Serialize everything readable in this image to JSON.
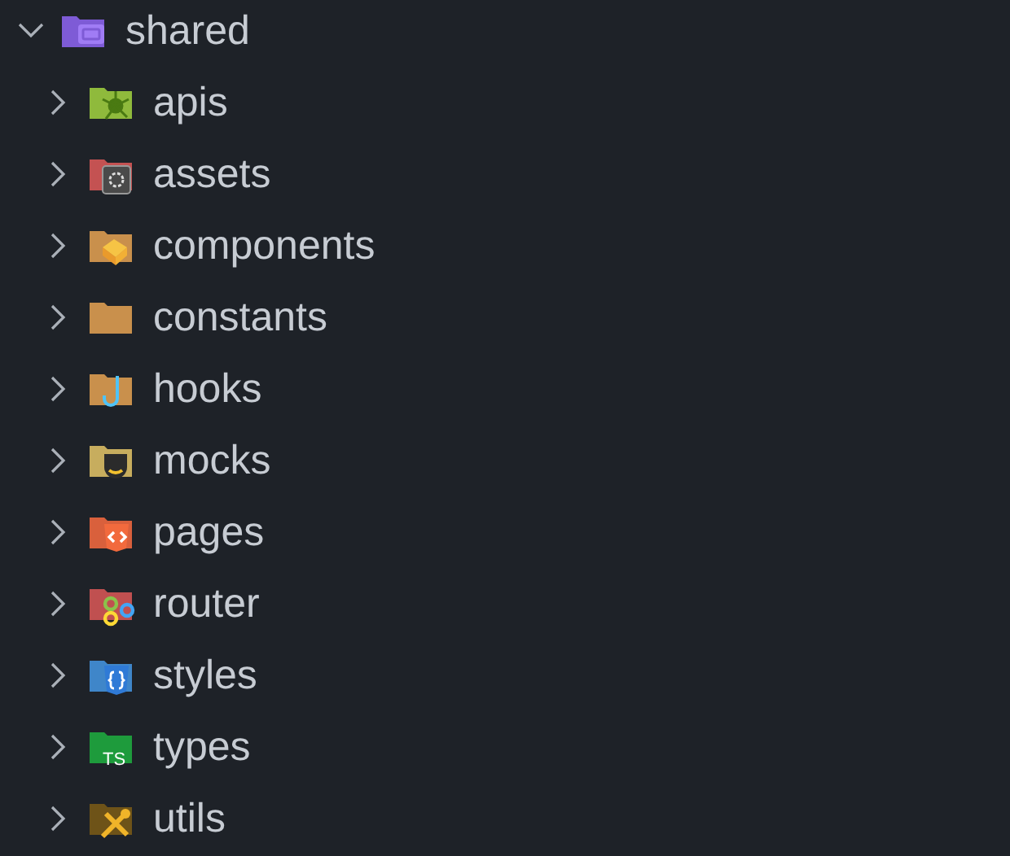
{
  "tree": {
    "label": "shared",
    "kind": "shared",
    "expanded": true,
    "children": [
      {
        "label": "apis",
        "kind": "apis",
        "expanded": false
      },
      {
        "label": "assets",
        "kind": "assets",
        "expanded": false
      },
      {
        "label": "components",
        "kind": "components",
        "expanded": false
      },
      {
        "label": "constants",
        "kind": "plain",
        "expanded": false
      },
      {
        "label": "hooks",
        "kind": "hooks",
        "expanded": false
      },
      {
        "label": "mocks",
        "kind": "mocks",
        "expanded": false
      },
      {
        "label": "pages",
        "kind": "pages",
        "expanded": false
      },
      {
        "label": "router",
        "kind": "router",
        "expanded": false
      },
      {
        "label": "styles",
        "kind": "styles",
        "expanded": false
      },
      {
        "label": "types",
        "kind": "types",
        "expanded": false,
        "badge": "TS"
      },
      {
        "label": "utils",
        "kind": "utils",
        "expanded": false
      }
    ]
  }
}
